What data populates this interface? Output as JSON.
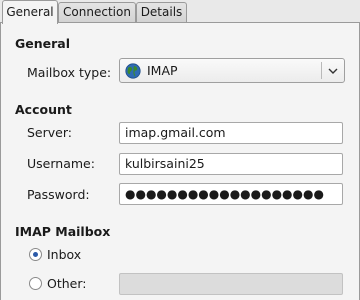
{
  "tabs": [
    {
      "label": "General",
      "active": true
    },
    {
      "label": "Connection",
      "active": false
    },
    {
      "label": "Details",
      "active": false
    }
  ],
  "general": {
    "title": "General",
    "mailbox_type_label": "Mailbox type:",
    "mailbox_type_value": "IMAP",
    "mailbox_type_icon": "globe-icon"
  },
  "account": {
    "title": "Account",
    "server_label": "Server:",
    "server_value": "imap.gmail.com",
    "username_label": "Username:",
    "username_value": "kulbirsaini25",
    "password_label": "Password:",
    "password_value": "●●●●●●●●●●●●●●●●●●●"
  },
  "imap_mailbox": {
    "title": "IMAP Mailbox",
    "inbox_label": "Inbox",
    "inbox_checked": true,
    "other_label": "Other:",
    "other_checked": false,
    "other_value": ""
  },
  "colors": {
    "radio_dot": "#2b5aa8",
    "globe_green": "#3c8a2e",
    "globe_blue": "#2f6bb3"
  }
}
